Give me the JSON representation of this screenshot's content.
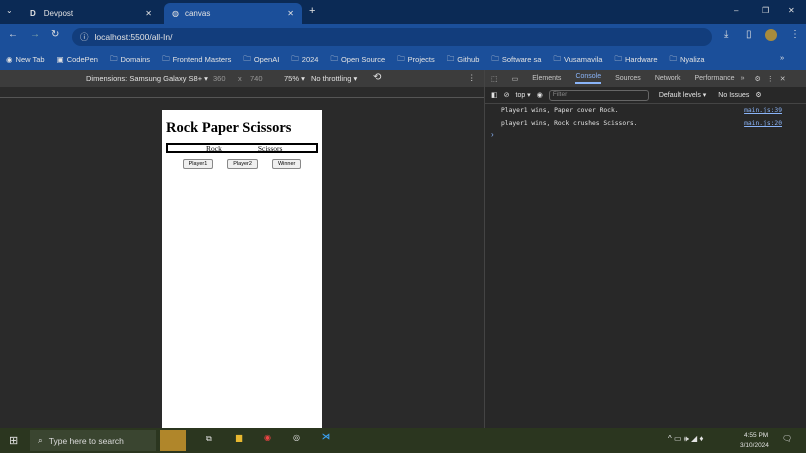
{
  "browser": {
    "tabs": [
      {
        "label": "Devpost",
        "icon": "D"
      },
      {
        "label": "canvas",
        "icon": "globe"
      }
    ],
    "url": "localhost:5500/all-In/",
    "bookmarks": [
      "New Tab",
      "CodePen",
      "Domains",
      "Frontend Masters",
      "OpenAI",
      "2024",
      "Open Source",
      "Projects",
      "Github",
      "Software sa",
      "Vusamavila",
      "Hardware",
      "Nyaliza"
    ]
  },
  "device_toolbar": {
    "dimensions": "Dimensions: Samsung Galaxy S8+ ▾",
    "width": "360",
    "x": "x",
    "height": "740",
    "zoom": "75% ▾",
    "throttling": "No throttling ▾"
  },
  "page": {
    "title": "Rock Paper Scissors",
    "player1_choice": "Rock",
    "player2_choice": "Scissors",
    "buttons": [
      "Player1",
      "Player2",
      "Winner"
    ]
  },
  "devtools": {
    "tabs": [
      "Elements",
      "Console",
      "Sources",
      "Network",
      "Performance"
    ],
    "context": "top ▾",
    "filter_placeholder": "Filter",
    "levels": "Default levels ▾",
    "issues": "No Issues",
    "logs": [
      {
        "text": "Player1 wins, Paper cover Rock.",
        "source": "main.js:39"
      },
      {
        "text": "player1 wins, Rock crushes Scissors.",
        "source": "main.js:20"
      }
    ],
    "prompt": "›"
  },
  "taskbar": {
    "search_placeholder": "Type here to search",
    "time": "4:55 PM",
    "date": "3/10/2024"
  }
}
